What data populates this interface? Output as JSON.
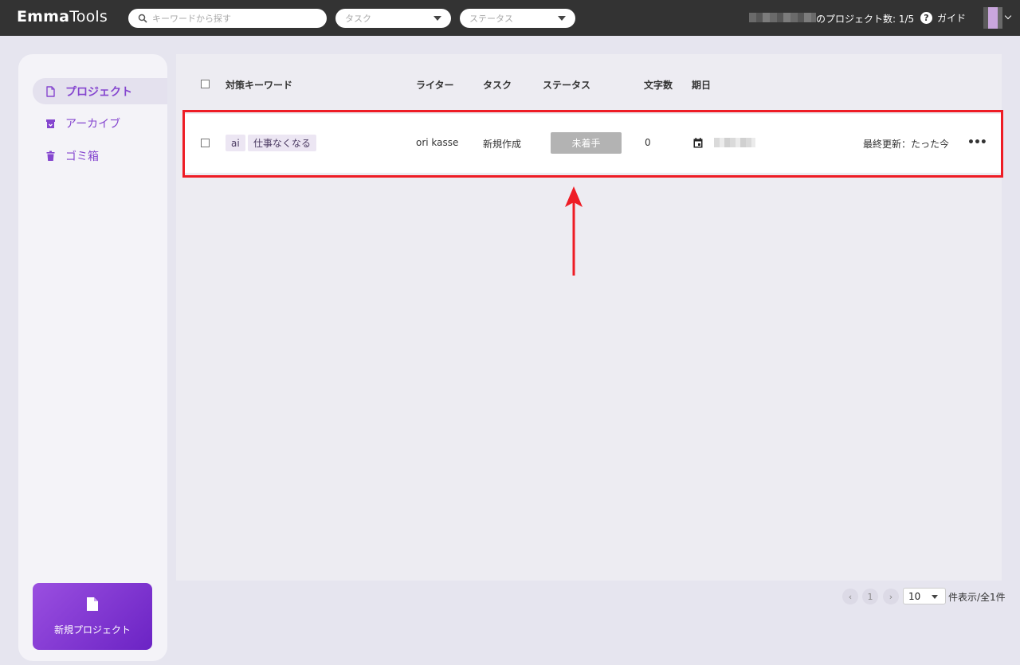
{
  "app": {
    "logo_bold": "Emma",
    "logo_light": "Tools"
  },
  "header": {
    "search_placeholder": "キーワードから探す",
    "task_filter": "タスク",
    "status_filter": "ステータス",
    "project_count": "のプロジェクト数: 1/5",
    "guide_label": "ガイド"
  },
  "sidebar": {
    "items": [
      {
        "label": "プロジェクト",
        "icon": "document-icon",
        "active": true
      },
      {
        "label": "アーカイブ",
        "icon": "archive-icon",
        "active": false
      },
      {
        "label": "ゴミ箱",
        "icon": "trash-icon",
        "active": false
      }
    ],
    "new_project_label": "新規プロジェクト"
  },
  "table": {
    "columns": [
      "対策キーワード",
      "ライター",
      "タスク",
      "ステータス",
      "文字数",
      "期日"
    ],
    "rows": [
      {
        "keywords": [
          "ai",
          "仕事なくなる"
        ],
        "writer": "ori kasse",
        "task": "新規作成",
        "status": "未着手",
        "char_count": "0",
        "last_updated": "最終更新：たった今",
        "more": "•••"
      }
    ]
  },
  "pagination": {
    "prev": "‹",
    "page": "1",
    "next": "›",
    "per_page": "10",
    "summary": "件表示/全1件"
  },
  "colors": {
    "accent": "#8546cf",
    "highlight": "#ee1c25",
    "status_gray": "#b3b3b3"
  }
}
